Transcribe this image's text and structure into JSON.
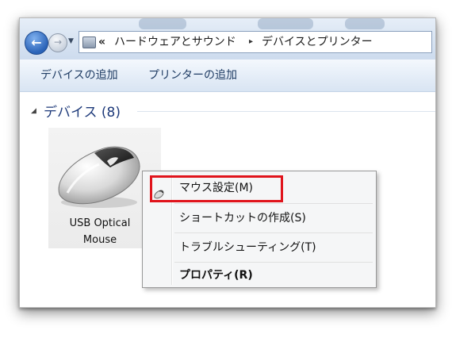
{
  "address_bar": {
    "breadcrumb_chevron": "«",
    "crumbs": [
      "ハードウェアとサウンド",
      "デバイスとプリンター"
    ],
    "separator": "▸",
    "back_icon": "back-arrow-icon",
    "forward_icon": "forward-arrow-icon",
    "folder_icon": "control-panel-icon"
  },
  "command_bar": {
    "add_device": "デバイスの追加",
    "add_printer": "プリンターの追加"
  },
  "group": {
    "title": "デバイス (8)"
  },
  "device": {
    "label_line1": "USB Optical",
    "label_line2": "Mouse",
    "icon": "mouse-icon"
  },
  "context_menu": {
    "items": [
      {
        "label": "マウス設定(M)",
        "icon": "mouse-settings-icon",
        "bold": false
      },
      {
        "label": "ショートカットの作成(S)",
        "bold": false
      },
      {
        "label": "トラブルシューティング(T)",
        "bold": false
      },
      {
        "label": "プロパティ(R)",
        "bold": true
      }
    ]
  },
  "colors": {
    "highlight_box": "#e0141c",
    "group_title": "#1e3a7a",
    "command_text": "#1e3b63"
  }
}
